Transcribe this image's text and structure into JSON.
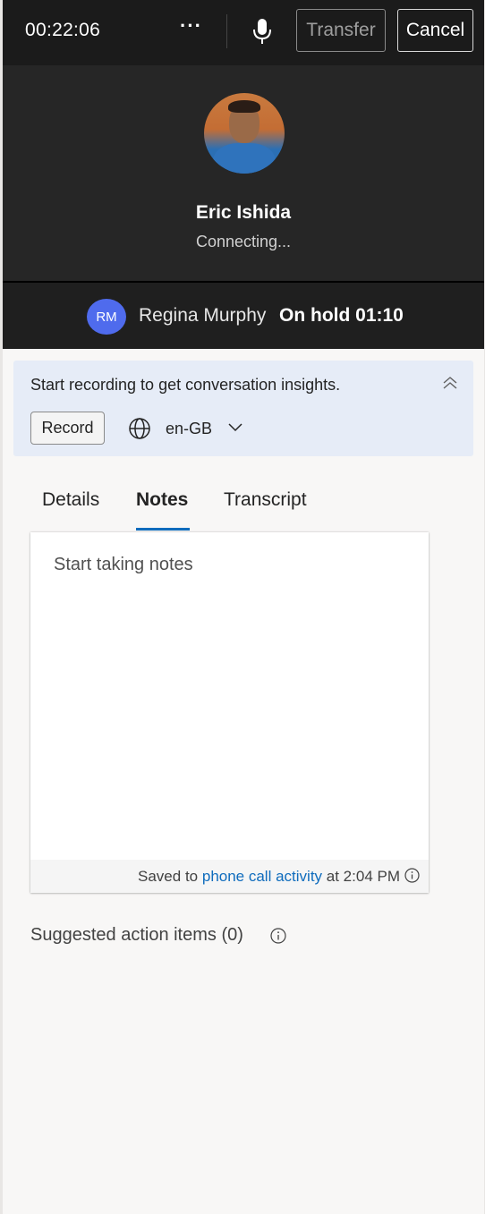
{
  "call": {
    "timer": "00:22:06",
    "more_label": "···",
    "transfer_label": "Transfer",
    "cancel_label": "Cancel"
  },
  "callee": {
    "name": "Eric Ishida",
    "status": "Connecting..."
  },
  "hold": {
    "initials": "RM",
    "name": "Regina Murphy",
    "status": "On hold 01:10",
    "avatar_color": "#4f6bed"
  },
  "insights": {
    "message": "Start recording to get conversation insights.",
    "record_label": "Record",
    "language": "en-GB"
  },
  "tabs": [
    {
      "label": "Details"
    },
    {
      "label": "Notes"
    },
    {
      "label": "Transcript"
    }
  ],
  "notes": {
    "placeholder": "Start taking notes",
    "saved_prefix": "Saved to",
    "saved_link": "phone call activity",
    "saved_suffix": "at 2:04 PM"
  },
  "suggested": {
    "label": "Suggested action items (0)"
  },
  "colors": {
    "accent": "#0f6cbd",
    "topbar_bg": "#1b1b1b",
    "banner_bg": "#e6ecf7"
  },
  "icons": [
    "more-icon",
    "microphone-icon",
    "collapse-icon",
    "globe-icon",
    "chevron-down-icon",
    "info-icon"
  ]
}
